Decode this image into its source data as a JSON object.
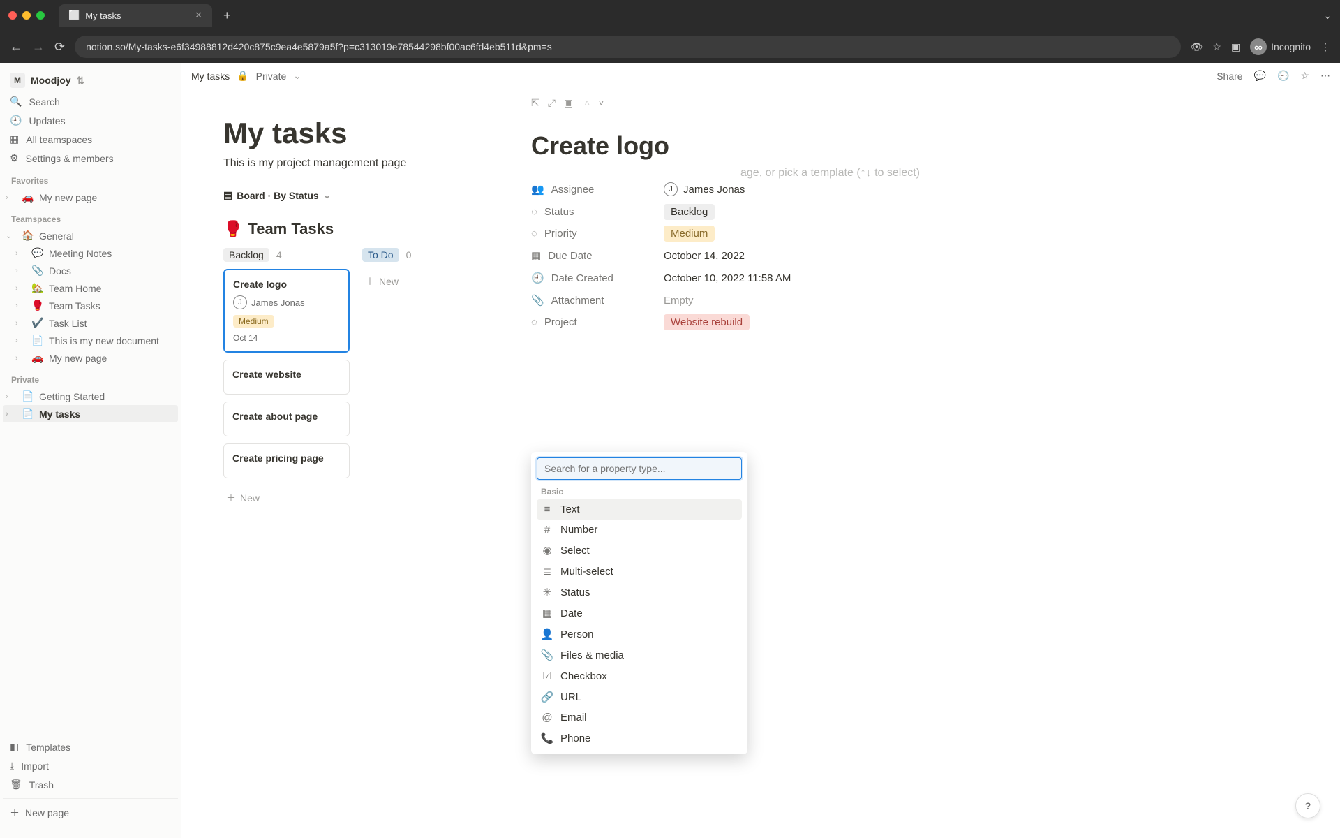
{
  "browser": {
    "tab_title": "My tasks",
    "url": "notion.so/My-tasks-e6f34988812d420c875c9ea4e5879a5f?p=c313019e78544298bf00ac6fd4eb511d&pm=s",
    "incognito_label": "Incognito"
  },
  "workspace": {
    "initial": "M",
    "name": "Moodjoy"
  },
  "sidebar_top": {
    "search": "Search",
    "updates": "Updates",
    "all_teamspaces": "All teamspaces",
    "settings": "Settings & members"
  },
  "sections": {
    "favorites": "Favorites",
    "teamspaces": "Teamspaces",
    "private": "Private"
  },
  "favorites": [
    {
      "emoji": "🚗",
      "label": "My new page"
    }
  ],
  "teamspaces": [
    {
      "emoji": "🏠",
      "label": "General",
      "children": [
        {
          "emoji": "💬",
          "label": "Meeting Notes"
        },
        {
          "emoji": "📎",
          "label": "Docs"
        },
        {
          "emoji": "🏡",
          "label": "Team Home"
        },
        {
          "emoji": "🥊",
          "label": "Team Tasks"
        },
        {
          "emoji": "✔️",
          "label": "Task List"
        },
        {
          "emoji": "📄",
          "label": "This is my new document"
        },
        {
          "emoji": "🚗",
          "label": "My new page"
        }
      ]
    }
  ],
  "private_pages": [
    {
      "emoji": "📄",
      "label": "Getting Started"
    },
    {
      "emoji": "📄",
      "label": "My tasks",
      "active": true
    }
  ],
  "sidebar_bottom": {
    "templates": "Templates",
    "import": "Import",
    "trash": "Trash",
    "new_page": "New page"
  },
  "breadcrumb": {
    "page": "My tasks",
    "privacy": "Private"
  },
  "topbar_actions": {
    "share": "Share"
  },
  "page": {
    "title": "My tasks",
    "description": "This is my project management page",
    "view_label": "Board · By Status",
    "group_title": "Team Tasks",
    "group_emoji": "🥊"
  },
  "board": {
    "columns": [
      {
        "name": "Backlog",
        "count": "4",
        "kind": "backlog",
        "cards": [
          {
            "title": "Create logo",
            "assignee": "James Jonas",
            "assignee_initial": "J",
            "priority": "Medium",
            "date": "Oct 14",
            "selected": true
          },
          {
            "title": "Create website"
          },
          {
            "title": "Create about page"
          },
          {
            "title": "Create pricing page"
          }
        ]
      },
      {
        "name": "To Do",
        "count": "0",
        "kind": "todo",
        "cards": []
      }
    ],
    "new_label": "New"
  },
  "detail": {
    "title": "Create logo",
    "properties": {
      "assignee": {
        "label": "Assignee",
        "value": "James Jonas",
        "initial": "J"
      },
      "status": {
        "label": "Status",
        "value": "Backlog"
      },
      "priority": {
        "label": "Priority",
        "value": "Medium"
      },
      "due_date": {
        "label": "Due Date",
        "value": "October 14, 2022"
      },
      "created": {
        "label": "Date Created",
        "value": "October 10, 2022 11:58 AM"
      },
      "attachment": {
        "label": "Attachment",
        "value": "Empty"
      },
      "project": {
        "label": "Project",
        "value": "Website rebuild"
      }
    },
    "placeholder_hint": "age, or pick a template (↑↓ to select)"
  },
  "popup": {
    "search_placeholder": "Search for a property type...",
    "section": "Basic",
    "items": [
      "Text",
      "Number",
      "Select",
      "Multi-select",
      "Status",
      "Date",
      "Person",
      "Files & media",
      "Checkbox",
      "URL",
      "Email",
      "Phone"
    ]
  },
  "help": "?"
}
